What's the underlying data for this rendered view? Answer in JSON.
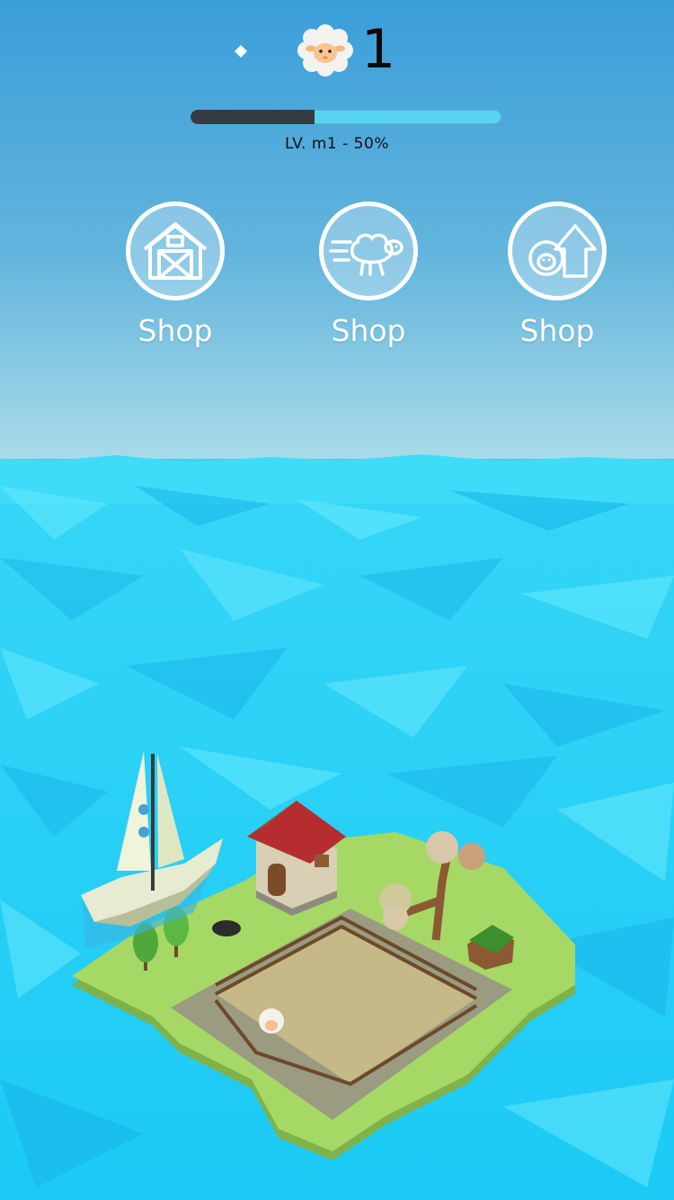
{
  "hud": {
    "sheep_count": "1",
    "level_label": "LV. m1 - 50%",
    "level_progress": 0.4
  },
  "shops": [
    {
      "icon": "barn-icon",
      "label": "Shop"
    },
    {
      "icon": "running-sheep-icon",
      "label": "Shop"
    },
    {
      "icon": "sheep-upgrade-icon",
      "label": "Shop"
    }
  ],
  "colors": {
    "sky_top": "#3a9fd8",
    "sky_bottom": "#a6dbe9",
    "water": "#22cdf5",
    "island_grass": "#9fd35e",
    "progress_track": "#58d4f2",
    "progress_fill": "#353d43"
  }
}
